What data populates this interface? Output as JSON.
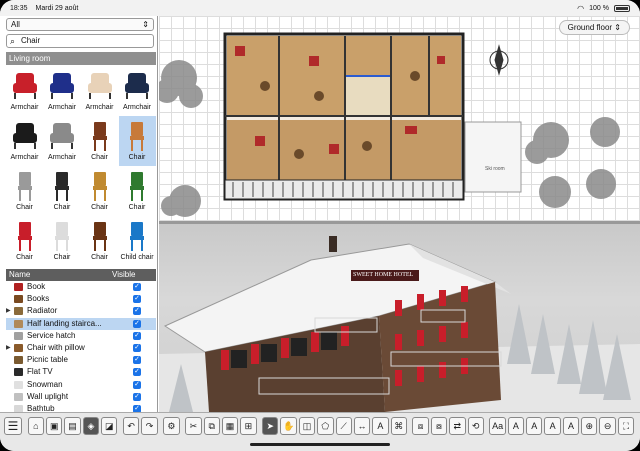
{
  "status": {
    "time": "18:35",
    "date": "Mardi 29 août",
    "battery": "100 %"
  },
  "catalog": {
    "category_select": "All",
    "search_value": "Chair",
    "group_header": "Living room",
    "items": [
      {
        "label": "Armchair",
        "color": "#c8202a"
      },
      {
        "label": "Armchair",
        "color": "#1f2f8a"
      },
      {
        "label": "Armchair",
        "color": "#e8d2b8"
      },
      {
        "label": "Armchair",
        "color": "#1c2c4c"
      },
      {
        "label": "Armchair",
        "color": "#1b1b1b"
      },
      {
        "label": "Armchair",
        "color": "#8a8a8a"
      },
      {
        "label": "Chair",
        "color": "#7a3a1c"
      },
      {
        "label": "Chair",
        "color": "#c77a3a"
      },
      {
        "label": "Chair",
        "color": "#9a9a9a"
      },
      {
        "label": "Chair",
        "color": "#2a2a2a"
      },
      {
        "label": "Chair",
        "color": "#c08a30"
      },
      {
        "label": "Chair",
        "color": "#2f7a2f"
      },
      {
        "label": "Chair",
        "color": "#c81e2a"
      },
      {
        "label": "Chair",
        "color": "#dcdcdc"
      },
      {
        "label": "Chair",
        "color": "#6a3414"
      },
      {
        "label": "Child chair",
        "color": "#1a78c8"
      }
    ]
  },
  "furniture_table": {
    "col_name": "Name",
    "col_visible": "Visible",
    "rows": [
      {
        "name": "Book",
        "icon_color": "#b02020",
        "expand": false,
        "selected": false
      },
      {
        "name": "Books",
        "icon_color": "#7a4a20",
        "expand": false,
        "selected": false
      },
      {
        "name": "Radiator",
        "icon_color": "#8a6a3a",
        "expand": true,
        "selected": false
      },
      {
        "name": "Half landing stairca...",
        "icon_color": "#b08a5a",
        "expand": false,
        "selected": true
      },
      {
        "name": "Service hatch",
        "icon_color": "#a0a0a0",
        "expand": false,
        "selected": false
      },
      {
        "name": "Chair with pillow",
        "icon_color": "#8a5a2a",
        "expand": true,
        "selected": false
      },
      {
        "name": "Picnic table",
        "icon_color": "#7a5a30",
        "expand": false,
        "selected": false
      },
      {
        "name": "Flat TV",
        "icon_color": "#2a2a2a",
        "expand": false,
        "selected": false
      },
      {
        "name": "Snowman",
        "icon_color": "#e0e0e0",
        "expand": false,
        "selected": false
      },
      {
        "name": "Wall uplight",
        "icon_color": "#c0c0c0",
        "expand": false,
        "selected": false
      },
      {
        "name": "Bathtub",
        "icon_color": "#d8d8d8",
        "expand": false,
        "selected": false
      }
    ]
  },
  "plan": {
    "level_selector": "Ground floor",
    "kitchen_label": "Ski room"
  },
  "view3d": {
    "sign_text": "SWEET HOME HOTEL"
  },
  "toolbar": {
    "buttons": [
      {
        "icon": "menu-icon",
        "glyph": "☰"
      },
      {
        "icon": "new-home-icon",
        "glyph": "⌂"
      },
      {
        "icon": "open-icon",
        "glyph": "▣"
      },
      {
        "icon": "save-icon",
        "glyph": "▤"
      },
      {
        "icon": "view-3d-icon",
        "glyph": "◈"
      },
      {
        "icon": "virtual-visit-icon",
        "glyph": "◪"
      },
      {
        "icon": "undo-icon",
        "glyph": "↶"
      },
      {
        "icon": "redo-icon",
        "glyph": "↷"
      },
      {
        "icon": "preferences-icon",
        "glyph": "⚙"
      },
      {
        "icon": "cut-icon",
        "glyph": "✂"
      },
      {
        "icon": "copy-icon",
        "glyph": "⧉"
      },
      {
        "icon": "paste-icon",
        "glyph": "▦"
      },
      {
        "icon": "add-furniture-icon",
        "glyph": "⊞"
      },
      {
        "icon": "select-mode-icon",
        "glyph": "➤"
      },
      {
        "icon": "pan-mode-icon",
        "glyph": "✋"
      },
      {
        "icon": "create-walls-icon",
        "glyph": "◫"
      },
      {
        "icon": "create-rooms-icon",
        "glyph": "⬠"
      },
      {
        "icon": "create-polylines-icon",
        "glyph": "⟋"
      },
      {
        "icon": "create-dimensions-icon",
        "glyph": "↔"
      },
      {
        "icon": "add-text-icon",
        "glyph": "A"
      },
      {
        "icon": "create-photo-icon",
        "glyph": "⌘"
      },
      {
        "icon": "group-icon",
        "glyph": "⧈"
      },
      {
        "icon": "ungroup-icon",
        "glyph": "⧇"
      },
      {
        "icon": "flip-icon",
        "glyph": "⇄"
      },
      {
        "icon": "rotate-icon",
        "glyph": "⟲"
      },
      {
        "icon": "text-style-icon",
        "glyph": "Aa"
      },
      {
        "icon": "bold-icon",
        "glyph": "A"
      },
      {
        "icon": "italic-icon",
        "glyph": "A"
      },
      {
        "icon": "increase-text-icon",
        "glyph": "A"
      },
      {
        "icon": "decrease-text-icon",
        "glyph": "A"
      },
      {
        "icon": "zoom-in-icon",
        "glyph": "⊕"
      },
      {
        "icon": "zoom-out-icon",
        "glyph": "⊖"
      },
      {
        "icon": "fit-icon",
        "glyph": "⛶"
      }
    ]
  }
}
